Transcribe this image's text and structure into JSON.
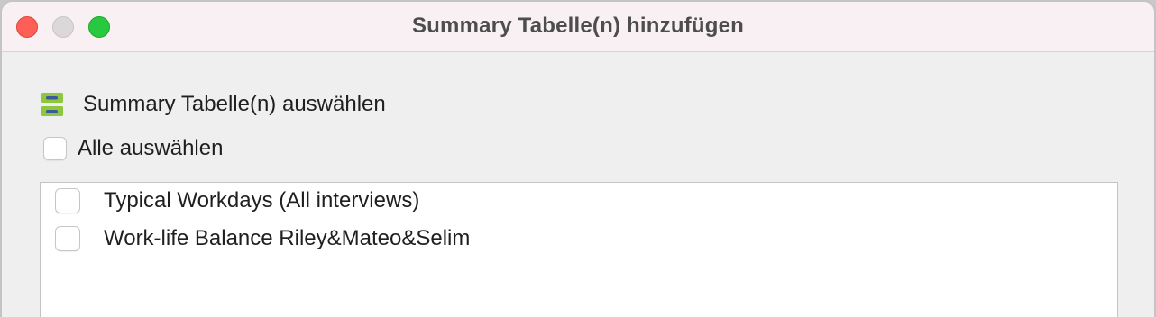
{
  "window": {
    "title": "Summary Tabelle(n) hinzufügen"
  },
  "section": {
    "icon": "summary-table-icon",
    "label": "Summary Tabelle(n) auswählen"
  },
  "select_all": {
    "label": "Alle auswählen",
    "checked": false
  },
  "tables": [
    {
      "label": "Typical Workdays (All interviews)",
      "checked": false
    },
    {
      "label": "Work-life Balance Riley&Mateo&Selim",
      "checked": false
    }
  ],
  "colors": {
    "titlebar": "#f8f0f2",
    "background": "#efefef",
    "icon_green": "#8ec63f",
    "icon_blue": "#3a5a9b",
    "close": "#fe5f57",
    "minimize": "#dcd8d9",
    "maximize": "#28c840"
  }
}
